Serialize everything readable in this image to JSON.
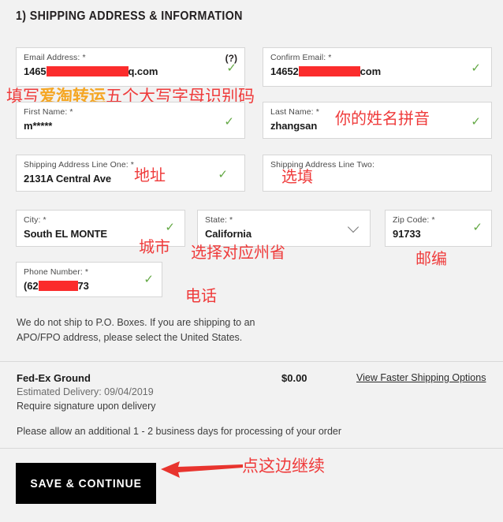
{
  "heading": "1) SHIPPING ADDRESS & INFORMATION",
  "colors": {
    "page_background": "#f2f2f2",
    "field_background": "#ffffff",
    "field_border": "#d6d6d6",
    "check_green": "#63a844",
    "annotation_red": "#ef3b3b",
    "annotation_gold": "#f5a623",
    "redaction_red": "#fb2c2c",
    "button_black": "#000000"
  },
  "fields": {
    "email": {
      "label": "Email Address: *",
      "value_prefix": "1465",
      "value_suffix": "q.com",
      "help_icon": "(?)",
      "valid_icon": "check-icon"
    },
    "confirm_email": {
      "label": "Confirm Email: *",
      "value_prefix": "14652",
      "value_suffix": "com",
      "valid_icon": "check-icon"
    },
    "first_name": {
      "label": "First Name: *",
      "value": "m*****",
      "valid_icon": "check-icon"
    },
    "last_name": {
      "label": "Last Name: *",
      "value": "zhangsan",
      "valid_icon": "check-icon"
    },
    "address_one": {
      "label": "Shipping Address Line One: *",
      "value": "2131A Central Ave",
      "valid_icon": "check-icon"
    },
    "address_two": {
      "label": "Shipping Address Line Two:",
      "value": ""
    },
    "city": {
      "label": "City: *",
      "value": "South EL MONTE",
      "valid_icon": "check-icon"
    },
    "state": {
      "label": "State: *",
      "value": "California",
      "dropdown_icon": "chevron-down-icon"
    },
    "zip": {
      "label": "Zip Code: *",
      "value": "91733",
      "valid_icon": "check-icon"
    },
    "phone": {
      "label": "Phone Number: *",
      "value_prefix": "(62",
      "value_suffix": "73",
      "valid_icon": "check-icon"
    }
  },
  "annotations": {
    "email_code_part1": "填写",
    "email_code_part2": "爱淘转运",
    "email_code_part3": "五个大写字母识别码",
    "last_name": "你的姓名拼音",
    "address_one": "地址",
    "address_two": "选填",
    "city": "城市",
    "state": "选择对应州省",
    "zip": "邮编",
    "phone": "电话",
    "continue": "点这边继续"
  },
  "po_note": "We do not ship to P.O. Boxes. If you are shipping to an APO/FPO address, please select the United States.",
  "shipping": {
    "method": "Fed-Ex Ground",
    "estimated_delivery": "Estimated Delivery: 09/04/2019",
    "signature": "Require signature upon delivery",
    "price": "$0.00",
    "faster_options_link": "View Faster Shipping Options",
    "processing_note": "Please allow an additional 1 - 2 business days for processing of your order"
  },
  "save_button": "SAVE & CONTINUE"
}
